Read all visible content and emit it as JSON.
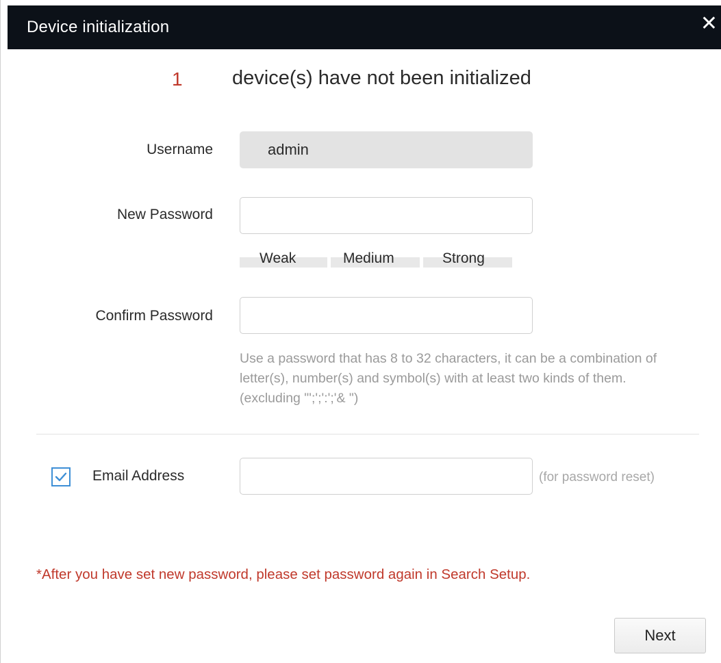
{
  "window": {
    "title": "Device initialization",
    "close_icon": "close-icon",
    "close_glyph": "✕"
  },
  "status": {
    "count": "1",
    "message": "device(s) have not been initialized"
  },
  "form": {
    "username_label": "Username",
    "username_value": "admin",
    "new_password_label": "New Password",
    "new_password_value": "",
    "strength_levels": [
      "Weak",
      "Medium",
      "Strong"
    ],
    "confirm_password_label": "Confirm Password",
    "confirm_password_value": "",
    "password_hint": "Use a password that has 8 to 32 characters, it can be a combination of letter(s), number(s) and symbol(s) with at least two kinds of them. (excluding \"';';':';'& \")",
    "email_checked": true,
    "email_label": "Email Address",
    "email_value": "",
    "email_note": "(for password reset)"
  },
  "warning": "*After you have set new password, please set password again in Search Setup.",
  "actions": {
    "next_label": "Next"
  },
  "colors": {
    "titlebar": "#0c1118",
    "accent_red": "#c0392b",
    "checkbox_blue": "#3d8fd6"
  }
}
